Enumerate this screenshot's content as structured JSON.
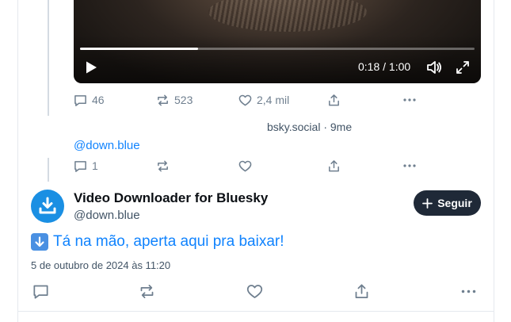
{
  "video": {
    "time_display": "0:18 / 1:00",
    "progress_fraction": 0.3
  },
  "repost_actions": {
    "replies": "46",
    "reposts": "523",
    "likes": "2,4 mil"
  },
  "source_line": "bsky.social · 9me",
  "reply": {
    "handle": "@down.blue",
    "replies": "1"
  },
  "post": {
    "display_name": "Video Downloader for Bluesky",
    "handle": "@down.blue",
    "follow_label": "Seguir",
    "text": "Tá na mão, aperta aqui pra baixar!",
    "date": "5 de outubro de 2024 às 11:20"
  },
  "colors": {
    "accent": "#1083fe",
    "icon": "#6f7f8f",
    "follow_bg": "#1f2937"
  }
}
